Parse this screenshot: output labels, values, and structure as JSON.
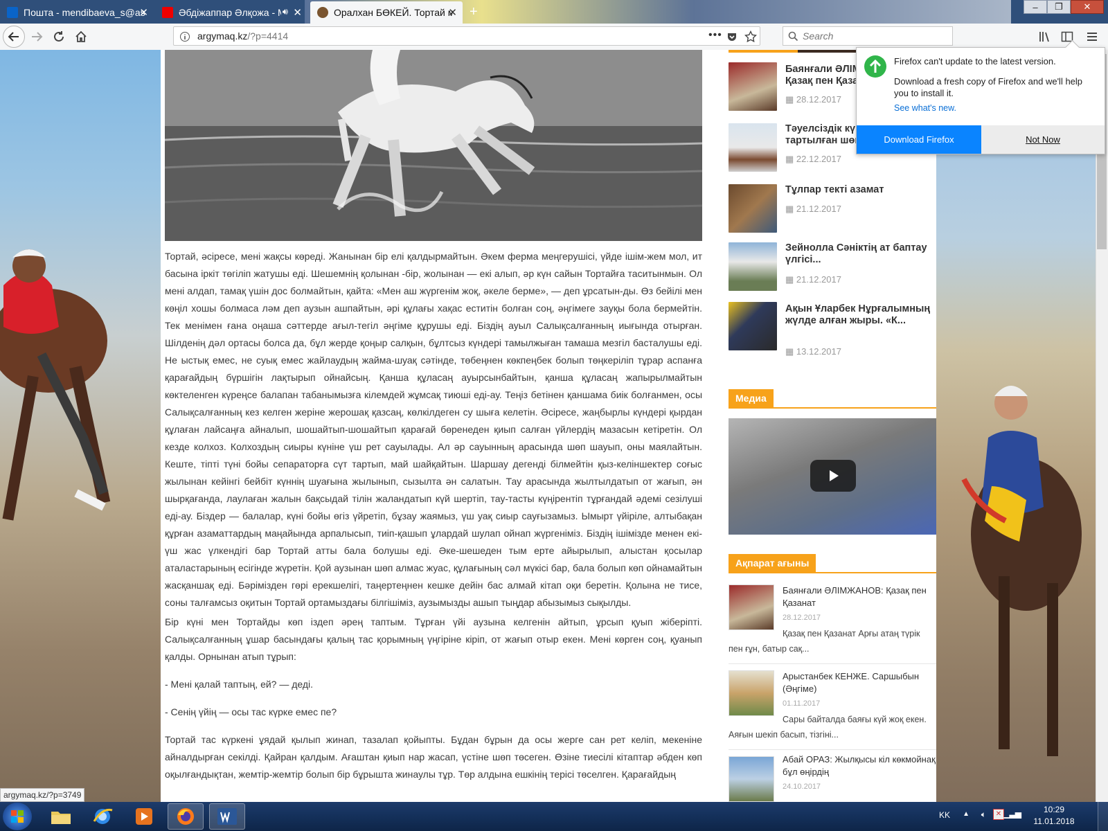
{
  "browser": {
    "tabs": [
      {
        "label": "Пошта - mendibaeva_s@ast.ni",
        "favicon": "outlook-icon",
        "active": false
      },
      {
        "label": "Әбдіжаппар Әлқожа - Ма",
        "favicon": "youtube-icon",
        "active": false,
        "audio": true
      },
      {
        "label": "Оралхан БӨКЕЙ. Тортай мінер",
        "favicon": "horse-icon",
        "active": true
      }
    ],
    "url_host": "argymaq.kz",
    "url_path": "/?p=4414",
    "search_placeholder": "Search"
  },
  "article": {
    "paragraphs": [
      "Тортай, әсіресе, мені жақсы көреді. Жанынан бір елі қалдырмайтын. Әкем ферма меңгерушісі, үйде ішім-жем мол, ит басына іркіт төгіліп жатушы еді. Шешемнің қолынан -бір, жолынан — екі алып, әр күн сайын Тортайға таситынмын. Ол мені алдап, тамақ үшін дос болмайтын, қайта: «Мен аш жүргенім жоқ, әкеле берме», — деп ұрсатын-ды. Өз бейілі мен көңіл хошы болмаса ләм деп аузын ашпайтын, әрі құлағы хақас еститін болған соң, әңгімеге зауқы бола бермейтін. Тек менімен ғана оңаша сәттерде ағыл-тегіл әңгіме құрушы еді. Біздің ауыл Салықсалғанның иығында отырған. Шілденің дәл ортасы болса да, бұл жерде қоңыр салқын, бұлтсыз күндері тамылжыған тамаша мезгіл басталушы еді. Не ыстық емес, не суық емес жайлаудың жайма-шуақ сәтінде, төбеңнен көкпеңбек болып төңкеріліп тұрар аспанға қарағайдың бүршігін лақтырып ойнайсың. Қанша құласаң ауырсынбайтын, қанша құласаң жапырылмайтын көктеленген күреңсе балапан табанымызға кілемдей жұмсақ тиюші еді-ау. Теңіз бетінен қаншама биік болғанмен, осы Салықсалғанның кез келген жеріне жерошақ қазсаң, көлкілдеген су шыға келетін. Әсіресе, жаңбырлы күндері қырдан құлаған лайсаңға айналып, шошайтып-шошайтып қарағай бөренеден қиып салған үйлердің мазасын кетіретін. Ол кезде колхоз. Колхоздың сиыры күніне үш рет сауылады. Ал әр сауынның арасында шөп шауып, оны маялайтын. Кеште, тіпті түні бойы сепараторға сүт тартып, май шайқайтын. Шаршау дегенді білмейтін қыз-келіншектер соғыс жылынан кейінгі бейбіт күннің шуағына жылынып, сызылта ән салатын. Тау арасында жылтылдатып от жағып, ән шырқағанда, лаулаған жалын бақсыдай тілін жаландатып күй шертіп, тау-тасты күңірентіп тұрғандай әдемі сезілуші еді-ау. Біздер — балалар, күні бойы өгіз үйретіп, бұзау жаямыз, үш уақ сиыр сауғызамыз. Ымырт үйіріле, алтыбақан құрған азаматтардың маңайында арпалысып, тиіп-қашып ұлардай шулап ойнап жүргеніміз. Біздің ішімізде менен екі-үш жас үлкендігі бар Тортай атты бала болушы еді. Әке-шешеден тым ерте айырылып, алыстан қосылар аталастарының есігінде жүретін. Қой аузынан шөп алмас жуас, құлағының сәл мүкісі бар, бала болып көп ойнамайтын жасқаншақ еді. Бәрімізден гөрі ерекшелігі, таңертеңнен кешке дейін бас алмай кітап оқи беретін. Қолына не тисе, соны талғамсыз оқитын Тортай ортамыздағы білгішіміз, аузымызды ашып тыңдар абызымыз сықылды.",
      "Бір күні мен Тортайды көп іздеп әрең таптым. Тұрған үйі аузына келгенін айтып, ұрсып қуып жіберіпті. Салықсалғанның ұшар басындағы қалың тас қорымның үңгіріне кіріп, от жағып отыр екен. Мені көрген соң, қуанып қалды. Орнынан атып тұрып:",
      "- Мені қалай таптың, ей? — деді.",
      "- Сенің үйің — осы тас күрке емес пе?",
      "Тортай тас күркені ұядай қылып жинап, тазалап қойыпты. Бұдан бұрын да осы жерге сан рет келіп, мекеніне айналдырған секілді. Қайран қалдым. Ағаштан қиып нар жасап, үстіне шөп төсеген. Өзіне тиесілі кітаптар әбден көп оқылғандықтан, жемтір-жемтір болып бір бұрышта жинаулы тұр. Төр алдына ешкінің терісі төселген. Қарағайдың"
    ]
  },
  "sidebar": {
    "recent": [
      {
        "title": "Баянғали ӘЛІМЖАНОВ: Қазақ пен Қазанат",
        "date": "28.12.2017"
      },
      {
        "title": "Тәуелсіздік күнінде тартылған шөгеннен ел ұпай",
        "date": "22.12.2017"
      },
      {
        "title": "Тұлпар текті азамат",
        "date": "21.12.2017"
      },
      {
        "title": "Зейнолла Сәніктің ат баптау үлгісі...",
        "date": "21.12.2017"
      },
      {
        "title": "Ақын Ұларбек Нұрғалымның жүлде алған жыры. «К...",
        "date": "13.12.2017"
      }
    ],
    "media_heading": "Медиа",
    "feed_heading": "Ақпарат ағыны",
    "feed": [
      {
        "title": "Баянғали ӘЛІМЖАНОВ: Қазақ пен Қазанат",
        "date": "28.12.2017",
        "excerpt": "Қазақ пен Қазанат Арғы атаң түрік пен ғұн, батыр сақ..."
      },
      {
        "title": "Арыстанбек КЕНЖЕ. Саршыбын (Әңгіме)",
        "date": "01.11.2017",
        "excerpt": "Сары байталда баяғы күй жоқ екен. Аяғын шекіп басып, тізгіні..."
      },
      {
        "title": "Абай ОРАЗ: Жылқысы кіл көкмойнақ бұл өңірдің",
        "date": "24.10.2017",
        "excerpt": ""
      }
    ]
  },
  "update_popup": {
    "title": "Firefox can't update to the latest version.",
    "body": "Download a fresh copy of Firefox and we'll help you to install it.",
    "link": "See what's new.",
    "primary_button": "Download Firefox",
    "secondary_button": "Not Now"
  },
  "status_bar": {
    "url": "argymaq.kz/?p=3749"
  },
  "taskbar": {
    "lang": "KK",
    "time": "10:29",
    "date": "11.01.2018"
  },
  "colors": {
    "accent_orange": "#f7a21a",
    "firefox_blue": "#0a84ff"
  }
}
